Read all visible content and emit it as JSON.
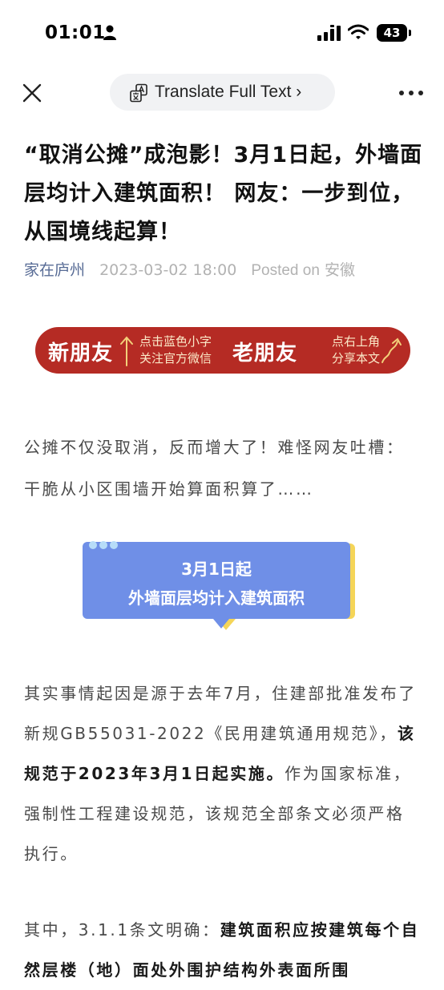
{
  "status_bar": {
    "time": "01:01",
    "battery": "43",
    "icons": [
      "person-icon",
      "signal-icon",
      "wifi-icon",
      "battery-icon"
    ]
  },
  "nav": {
    "translate_label": "Translate Full Text ›",
    "icons": [
      "close-icon",
      "translate-icon",
      "more-icon"
    ]
  },
  "article": {
    "title": "“取消公摊”成泡影！3月1日起，外墙面层均计入建筑面积！ 网友：一步到位，从国境线起算！",
    "account": "家在庐州",
    "date": "2023-03-02 18:00",
    "posted_label": "Posted on",
    "location": "安徽"
  },
  "banner": {
    "new_friend": "新朋友",
    "new_hint_line1": "点击蓝色小字",
    "new_hint_line2": "关注官方微信",
    "old_friend": "老朋友",
    "old_hint_line1": "点右上角",
    "old_hint_line2": "分享本文"
  },
  "body": {
    "para1": "公摊不仅没取消，反而增大了！难怪网友吐槽：干脆从小区围墙开始算面积算了……",
    "card_line1": "3月1日起",
    "card_line2": "外墙面层均计入建筑面积",
    "para2_a": "其实事情起因是源于去年7月，住建部批准发布了新规GB55031-2022《民用建筑通用规范》，",
    "para2_bold": "该规范于2023年3月1日起实施。",
    "para2_b": "作为国家标准，强制性工程建设规范，该规范全部条文必须严格执行。",
    "para3_a": "其中，3.1.1条文明确：",
    "para3_bold": "建筑面积应按建筑每个自然层楼（地）面处外围护结构外表面所围"
  },
  "colors": {
    "account_link": "#576b95",
    "banner_red": "#b52b24",
    "card_blue": "#6f8fe7",
    "card_yellow": "#f5d558"
  }
}
